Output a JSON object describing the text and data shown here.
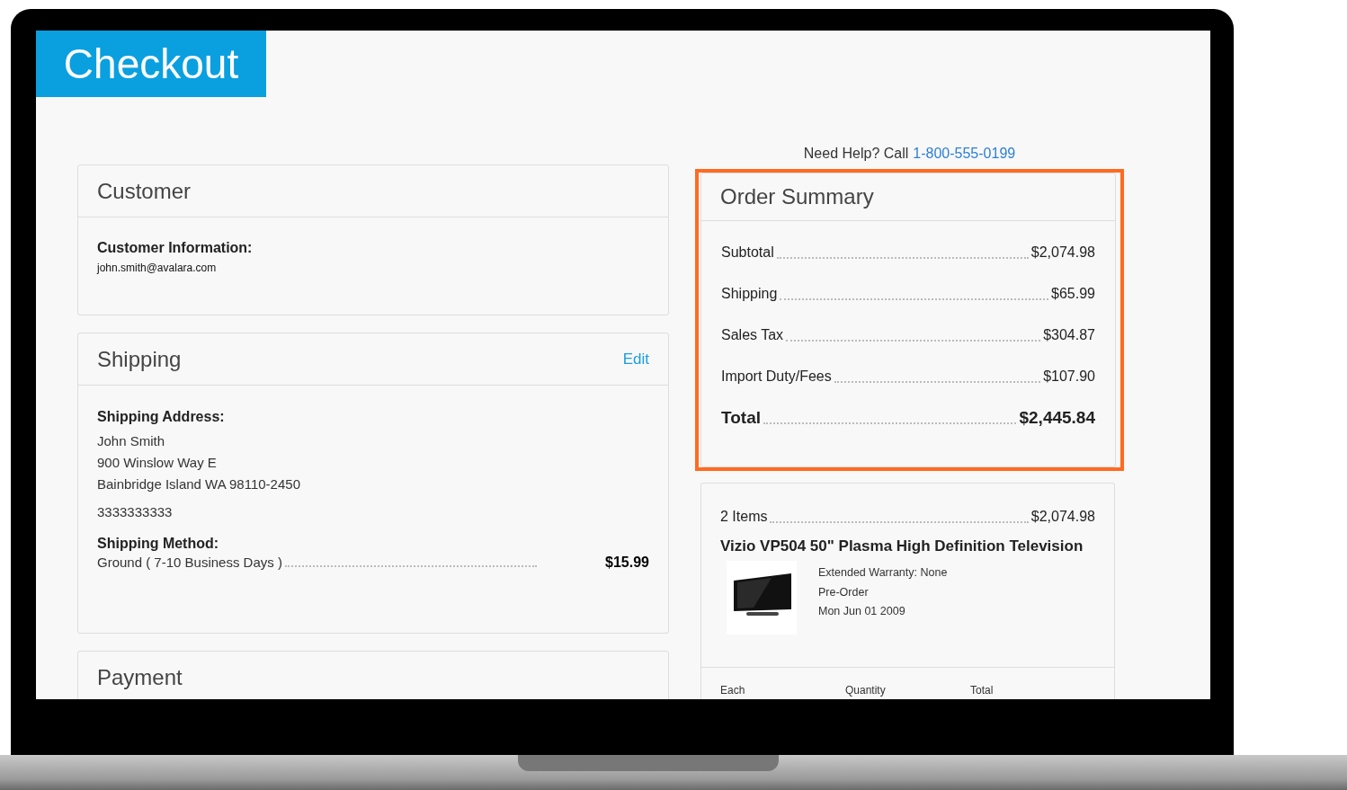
{
  "header": {
    "title": "Checkout"
  },
  "help": {
    "text": "Need Help? Call",
    "phone": "1-800-555-0199"
  },
  "customer": {
    "title": "Customer",
    "label": "Customer Information:",
    "email": "john.smith@avalara.com"
  },
  "shipping": {
    "title": "Shipping",
    "edit": "Edit",
    "address_label": "Shipping Address:",
    "address_lines": [
      "John Smith",
      "900 Winslow Way E",
      "Bainbridge Island WA 98110-2450"
    ],
    "phone": "3333333333",
    "method_label": "Shipping Method:",
    "method": "Ground ( 7-10 Business Days )",
    "method_price": "$15.99"
  },
  "payment": {
    "title": "Payment"
  },
  "order_summary": {
    "title": "Order Summary",
    "highlighted": true,
    "lines": [
      {
        "label": "Subtotal",
        "amount": "$2,074.98",
        "kind": "line"
      },
      {
        "label": "Shipping",
        "amount": "$65.99",
        "kind": "line"
      },
      {
        "label": "Sales Tax",
        "amount": "$304.87",
        "kind": "line"
      },
      {
        "label": "Import Duty/Fees",
        "amount": "$107.90",
        "kind": "line"
      },
      {
        "label": "Total",
        "amount": "$2,445.84",
        "kind": "total"
      }
    ]
  },
  "items": {
    "count": "2 Items",
    "amount": "$2,074.98",
    "products": [
      {
        "name": "Vizio VP504 50\" Plasma High Definition Television",
        "kind": "picture",
        "details": [
          "Extended Warranty: None",
          "Pre-Order",
          "Mon Jun 01 2009"
        ]
      }
    ],
    "columns": [
      "Each",
      "Quantity",
      "Total"
    ]
  }
}
